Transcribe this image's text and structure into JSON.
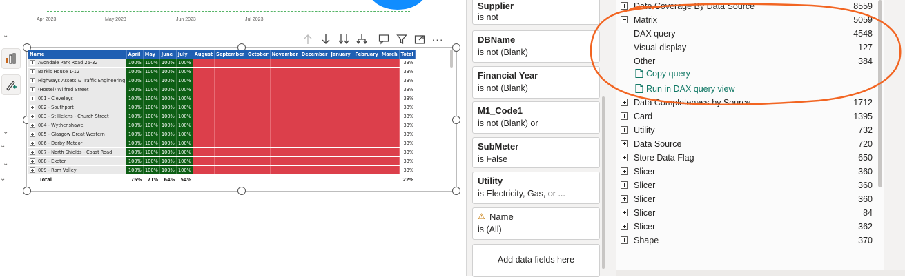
{
  "mini_chart": {
    "months": [
      "Apr 2023",
      "May 2023",
      "Jun 2023",
      "Jul 2023"
    ],
    "line_color": "#55b466"
  },
  "rail": {
    "icons": [
      "report-view-icon",
      "format-visual-icon"
    ]
  },
  "visual_header": {
    "icons": [
      "drill-up-icon",
      "drill-down-icon",
      "expand-all-icon",
      "expand-hierarchy-icon",
      "comment-icon",
      "filter-icon",
      "focus-mode-icon",
      "more-options-icon"
    ]
  },
  "matrix": {
    "header_color": "#1f5fb3",
    "good_color": "#0d5e14",
    "bad_color": "#dc3f4b",
    "columns": [
      "Name",
      "April",
      "May",
      "June",
      "July",
      "August",
      "September",
      "October",
      "November",
      "December",
      "January",
      "February",
      "March",
      "Total"
    ],
    "rows": [
      {
        "name": "Avondale Park Road 26-32",
        "values": [
          "100%",
          "100%",
          "100%",
          "100%"
        ],
        "total": "33%"
      },
      {
        "name": "Barkis House 1-12",
        "values": [
          "100%",
          "100%",
          "100%",
          "100%"
        ],
        "total": "33%"
      },
      {
        "name": "Highways Assets & Traffic Engineering",
        "values": [
          "100%",
          "100%",
          "100%",
          "100%"
        ],
        "total": "33%"
      },
      {
        "name": "(Hostel) Wilfred Street",
        "values": [
          "100%",
          "100%",
          "100%",
          "100%"
        ],
        "total": "33%"
      },
      {
        "name": "001 - Cleveleys",
        "values": [
          "100%",
          "100%",
          "100%",
          "100%"
        ],
        "total": "33%"
      },
      {
        "name": "002 - Southport",
        "values": [
          "100%",
          "100%",
          "100%",
          "100%"
        ],
        "total": "33%"
      },
      {
        "name": "003 - St Helens - Church Street",
        "values": [
          "100%",
          "100%",
          "100%",
          "100%"
        ],
        "total": "33%"
      },
      {
        "name": "004 - Wythenshawe",
        "values": [
          "100%",
          "100%",
          "100%",
          "100%"
        ],
        "total": "33%"
      },
      {
        "name": "005 - Glasgow Great Western",
        "values": [
          "100%",
          "100%",
          "100%",
          "100%"
        ],
        "total": "33%"
      },
      {
        "name": "006 - Derby Meteor",
        "values": [
          "100%",
          "100%",
          "100%",
          "100%"
        ],
        "total": "33%"
      },
      {
        "name": "007 - North Shields - Coast Road",
        "values": [
          "100%",
          "100%",
          "100%",
          "100%"
        ],
        "total": "33%"
      },
      {
        "name": "008 - Exeter",
        "values": [
          "100%",
          "100%",
          "100%",
          "100%"
        ],
        "total": "33%"
      },
      {
        "name": "009 - Rom Valley",
        "values": [
          "100%",
          "100%",
          "100%",
          "100%"
        ],
        "total": "33%"
      }
    ],
    "total_row": {
      "label": "Total",
      "values": [
        "75%",
        "71%",
        "64%",
        "54%"
      ],
      "total": "22%"
    }
  },
  "filters": [
    {
      "title": "Supplier",
      "value": "is not"
    },
    {
      "title": "DBName",
      "value": "is not (Blank)"
    },
    {
      "title": "Financial Year",
      "value": "is not (Blank)"
    },
    {
      "title": "M1_Code1",
      "value": "is not (Blank) or"
    },
    {
      "title": "SubMeter",
      "value": "is False"
    },
    {
      "title": "Utility",
      "value": "is Electricity, Gas, or ..."
    },
    {
      "title": "Name",
      "value": "is (All)",
      "warning": true
    }
  ],
  "add_fields": "Add data fields here",
  "performance": {
    "top": {
      "label": "Date Coverage By Data Source",
      "value": "8559"
    },
    "expanded": {
      "label": "Matrix",
      "value": "5059"
    },
    "sub_items": [
      {
        "label": "DAX query",
        "value": "4548"
      },
      {
        "label": "Visual display",
        "value": "127"
      },
      {
        "label": "Other",
        "value": "384"
      }
    ],
    "links": [
      "Copy query",
      "Run in DAX query view"
    ],
    "items": [
      {
        "label": "Data Completeness by Source",
        "value": "1712"
      },
      {
        "label": "Card",
        "value": "1395"
      },
      {
        "label": "Utility",
        "value": "732"
      },
      {
        "label": "Data Source",
        "value": "720"
      },
      {
        "label": "Store Data Flag",
        "value": "650"
      },
      {
        "label": "Slicer",
        "value": "360"
      },
      {
        "label": "Slicer",
        "value": "360"
      },
      {
        "label": "Slicer",
        "value": "360"
      },
      {
        "label": "Slicer",
        "value": "84"
      },
      {
        "label": "Slicer",
        "value": "362"
      },
      {
        "label": "Shape",
        "value": "370"
      }
    ],
    "annotation_color": "#f26522"
  }
}
